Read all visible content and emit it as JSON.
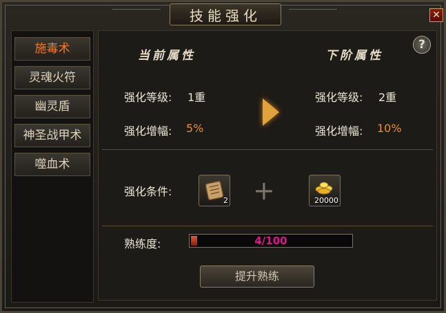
{
  "window": {
    "title": "技能强化",
    "close_glyph": "✕"
  },
  "sidebar": {
    "items": [
      {
        "label": "施毒术",
        "active": true
      },
      {
        "label": "灵魂火符",
        "active": false
      },
      {
        "label": "幽灵盾",
        "active": false
      },
      {
        "label": "神圣战甲术",
        "active": false
      },
      {
        "label": "噬血术",
        "active": false
      }
    ]
  },
  "help_glyph": "?",
  "current": {
    "header": "当前属性",
    "level_label": "强化等级:",
    "level_value": "1重",
    "boost_label": "强化增幅:",
    "boost_value": "5%"
  },
  "next": {
    "header": "下阶属性",
    "level_label": "强化等级:",
    "level_value": "2重",
    "boost_label": "强化增幅:",
    "boost_value": "10%"
  },
  "conditions": {
    "label": "强化条件:",
    "plus_glyph": "+",
    "items": [
      {
        "icon": "scroll-icon",
        "qty": "2"
      },
      {
        "icon": "gold-coins-icon",
        "qty": "20000"
      }
    ]
  },
  "proficiency": {
    "label": "熟练度:",
    "text": "4/100",
    "current": 4,
    "max": 100
  },
  "upgrade_button": "提升熟练",
  "colors": {
    "accent": "#f08c2a",
    "active_tab": "#f07a2a",
    "progress_text": "#e0148c"
  }
}
